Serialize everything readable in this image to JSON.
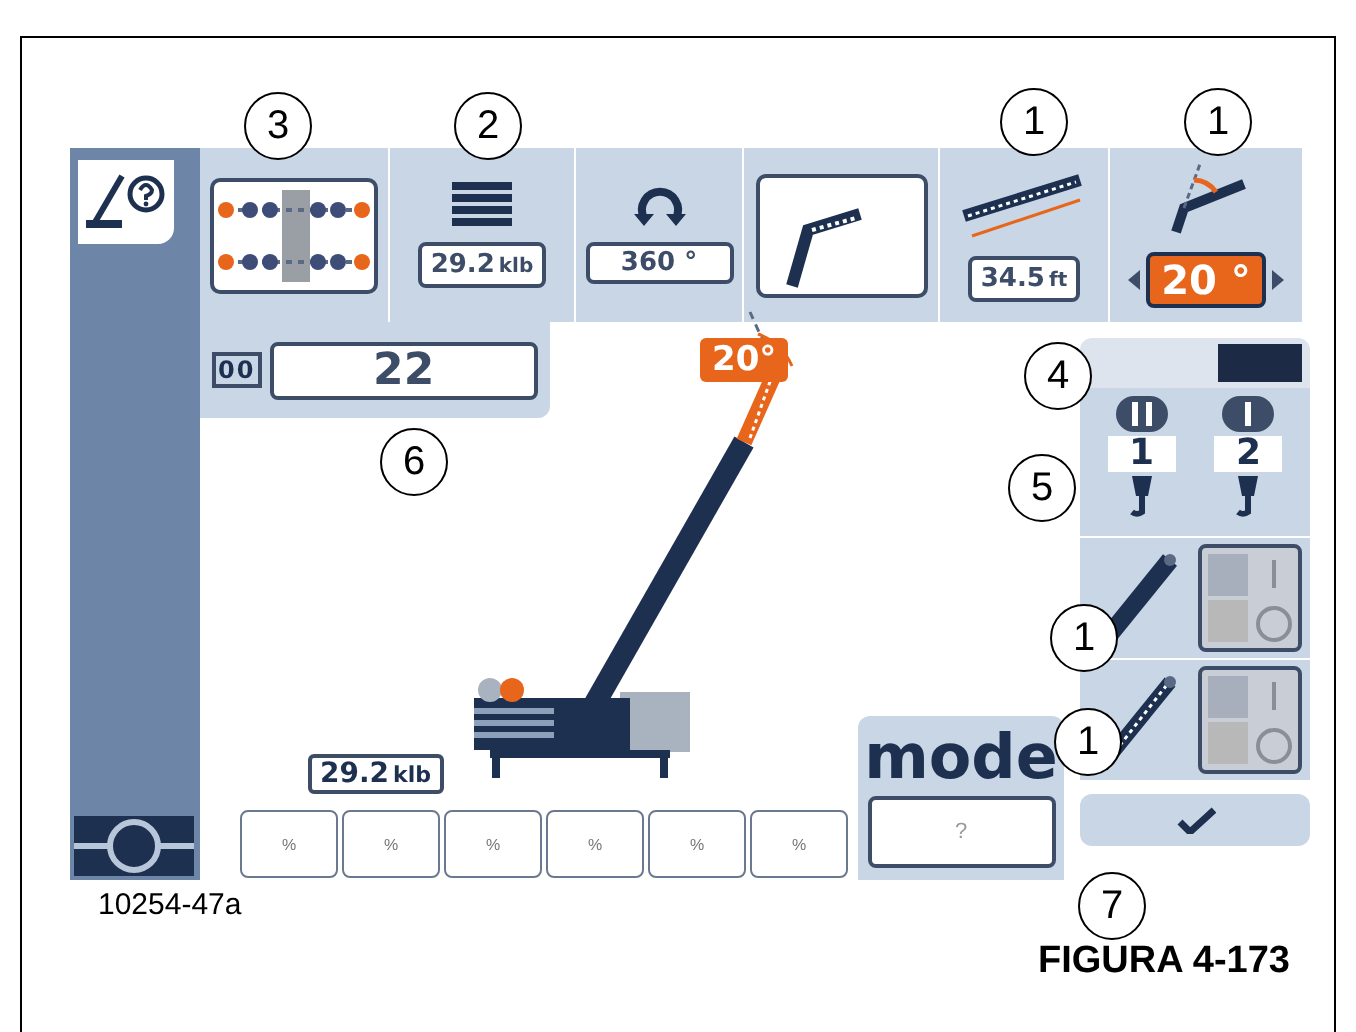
{
  "top_bar": {
    "counterweight": {
      "value": "29.2",
      "unit": "klb"
    },
    "swing": {
      "value": "360 °"
    },
    "boom_length": {
      "value": "34.5",
      "unit": "ft"
    },
    "boom_angle": {
      "value": "20 °"
    }
  },
  "counter": {
    "symbol": "00",
    "value": "22"
  },
  "boom_angle_badge": "20°",
  "load": {
    "value": "29.2",
    "unit": "klb"
  },
  "percent_buttons": [
    "%",
    "%",
    "%",
    "%",
    "%",
    "%"
  ],
  "mode": {
    "label": "mode",
    "symbol": "?"
  },
  "hooks": [
    {
      "label": "1"
    },
    {
      "label": "2"
    }
  ],
  "toggles": [
    {
      "on": false
    },
    {
      "on": false
    }
  ],
  "callouts": [
    "3",
    "2",
    "1",
    "1",
    "4",
    "6",
    "5",
    "1",
    "1",
    "7"
  ],
  "figure": {
    "id": "10254-47a",
    "caption": "FIGURA 4-173"
  }
}
